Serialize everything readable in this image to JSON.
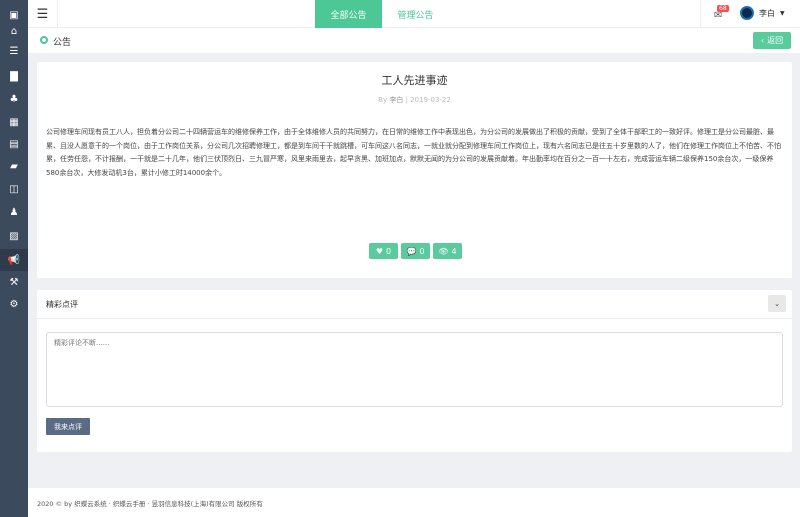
{
  "sidebar": {
    "items": [
      {
        "icon": "logo-icon",
        "glyph": "▣"
      },
      {
        "icon": "home-icon",
        "glyph": "⌂"
      },
      {
        "icon": "list-icon",
        "glyph": "☰"
      },
      {
        "icon": "briefcase-icon",
        "glyph": "▇"
      },
      {
        "icon": "users-icon",
        "glyph": "♣"
      },
      {
        "icon": "calendar-icon",
        "glyph": "▦"
      },
      {
        "icon": "card-icon",
        "glyph": "▤"
      },
      {
        "icon": "book-icon",
        "glyph": "▰"
      },
      {
        "icon": "columns-icon",
        "glyph": "◫"
      },
      {
        "icon": "person-icon",
        "glyph": "♟"
      },
      {
        "icon": "image-icon",
        "glyph": "▨"
      },
      {
        "icon": "bullhorn-icon",
        "glyph": "📢"
      },
      {
        "icon": "gavel-icon",
        "glyph": "⚒"
      },
      {
        "icon": "cogs-icon",
        "glyph": "⚙"
      }
    ],
    "active": 11
  },
  "header": {
    "tabs": [
      {
        "label": "全部公告"
      },
      {
        "label": "管理公告"
      }
    ],
    "notification_count": "68",
    "user": "李白"
  },
  "breadcrumb": {
    "title": "公告",
    "back_label": "返回"
  },
  "article": {
    "title": "工人先进事迹",
    "by": "By",
    "author": "李白",
    "separator": "|",
    "date": "2019-03-22",
    "body": "公司修理车间现有员工八人，担负着分公司二十四辆营运车的维修保养工作，由于全体维修人员的共同努力，在日常的维修工作中表现出色，为分公司的发展做出了积极的贡献，受到了全体干部职工的一致好评。修理工是分公司最脏、最累、且没人愿意干的一个岗位，由于工作岗位关系，分公司几次招聘修理工，都是到车间干干就跳槽，可车间这八名同志，一就业就分配到修理车间工作岗位上，现有六名同志已是往五十岁里数的人了，他们在修理工作岗位上不怕苦、不怕累，任劳任怨，不计报酬，一干就是二十几年，他们三伏顶烈日、三九冒严寒，风里来雨里去，起早贪黑、加班加点，默默无闻的为分公司的发展贡献着。年出勤率均在百分之一百一十左右，完成营运车辆二级保养150余台次，一级保养580余台次，大修发动机3台，累计小修工时14000余个。",
    "likes": "0",
    "comments": "0",
    "views": "4"
  },
  "comments": {
    "title": "精彩点评",
    "placeholder": "精彩评论不断......",
    "submit_label": "我来点评"
  },
  "footer": {
    "text": "2020 © by 织蝶云系统 · 织蝶云手册 · 昱羽信息科技(上海)有限公司 版权所有"
  },
  "colors": {
    "accent": "#4cc796",
    "sidebar": "#3c4a5e",
    "badge": "#f0504f",
    "submit": "#5a6b85"
  }
}
